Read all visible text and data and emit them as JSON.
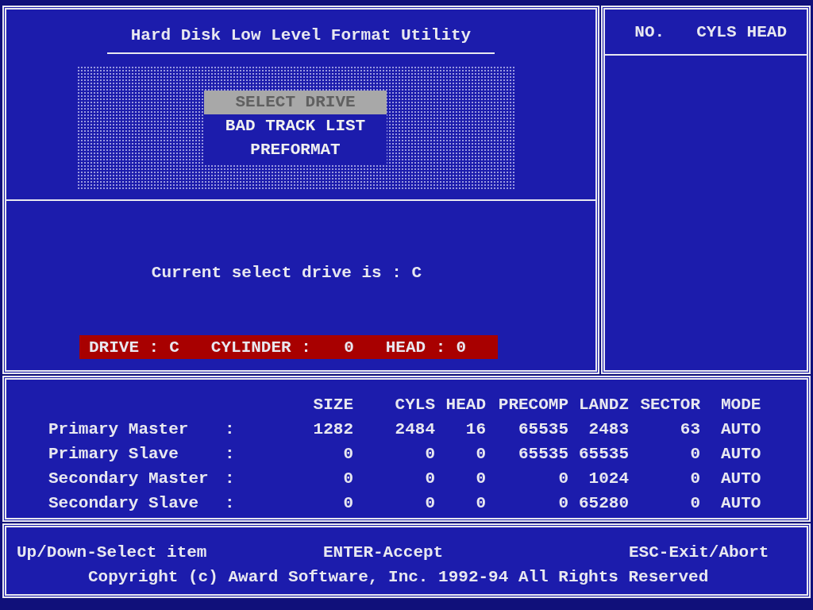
{
  "title": "Hard Disk Low Level Format Utility",
  "menu": [
    {
      "label": "SELECT DRIVE",
      "selected": true
    },
    {
      "label": "BAD TRACK LIST",
      "selected": false
    },
    {
      "label": "PREFORMAT",
      "selected": false
    }
  ],
  "current_drive": "Current select drive is : C",
  "status": [
    {
      "label": "DRIVE :",
      "value": "C"
    },
    {
      "label": "CYLINDER :",
      "value": "0"
    },
    {
      "label": "HEAD :",
      "value": "0"
    }
  ],
  "drive_list": {
    "columns": [
      "NO.",
      "CYLS",
      "HEAD"
    ]
  },
  "drives": {
    "columns": [
      "SIZE",
      "CYLS",
      "HEAD",
      "PRECOMP",
      "LANDZ",
      "SECTOR",
      "MODE"
    ],
    "rows": [
      {
        "name": "Primary Master",
        "separator": ":",
        "values": [
          "1282",
          "2484",
          "16",
          "65535",
          "2483",
          "63",
          "AUTO"
        ]
      },
      {
        "name": "Primary Slave",
        "separator": ":",
        "values": [
          "0",
          "0",
          "0",
          "65535",
          "65535",
          "0",
          "AUTO"
        ]
      },
      {
        "name": "Secondary Master",
        "separator": ":",
        "values": [
          "0",
          "0",
          "0",
          "0",
          "1024",
          "0",
          "AUTO"
        ]
      },
      {
        "name": "Secondary Slave",
        "separator": ":",
        "values": [
          "0",
          "0",
          "0",
          "0",
          "65280",
          "0",
          "AUTO"
        ]
      }
    ]
  },
  "footer": {
    "hints": [
      "Up/Down-Select item",
      "ENTER-Accept",
      "ESC-Exit/Abort"
    ],
    "copyright": "Copyright (c) Award Software, Inc. 1992-94 All Rights Reserved"
  }
}
